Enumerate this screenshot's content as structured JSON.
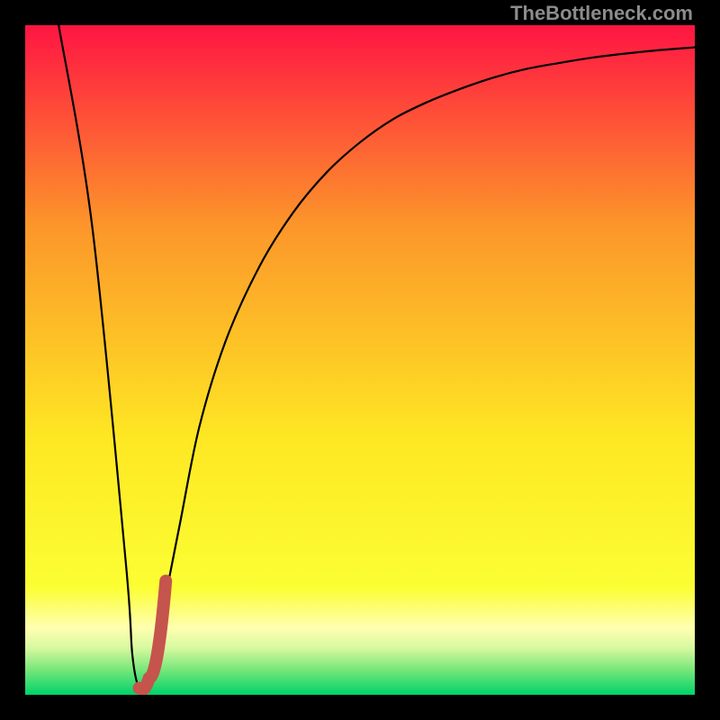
{
  "watermark": "TheBottleneck.com",
  "colors": {
    "frame": "#000000",
    "curve": "#000000",
    "marker": "#c5544d",
    "gradient_stop_top": "#ff1543",
    "gradient_stop_upper": "#fc962a",
    "gradient_stop_mid": "#fee823",
    "gradient_stop_pale": "#ffffb0",
    "gradient_stop_green1": "#9cf07e",
    "gradient_stop_green2": "#00d56a"
  },
  "chart_data": {
    "type": "line",
    "title": "",
    "xlabel": "",
    "ylabel": "",
    "xlim": [
      0,
      100
    ],
    "ylim": [
      0,
      100
    ],
    "series": [
      {
        "name": "bottleneck-curve",
        "x": [
          5,
          10,
          15,
          16,
          17,
          18,
          20,
          23,
          26,
          30,
          35,
          40,
          45,
          50,
          55,
          60,
          65,
          70,
          75,
          80,
          85,
          90,
          95,
          100
        ],
        "y": [
          100,
          70,
          20,
          6,
          1,
          2,
          10,
          25,
          40,
          53,
          64,
          72,
          78,
          82.5,
          86,
          88.5,
          90.5,
          92.2,
          93.5,
          94.4,
          95.2,
          95.8,
          96.3,
          96.7
        ]
      }
    ],
    "marker": {
      "name": "selected-region",
      "x_path": [
        17,
        17.5,
        18.5,
        21
      ],
      "y_path": [
        1,
        0.8,
        2.5,
        17
      ]
    }
  }
}
